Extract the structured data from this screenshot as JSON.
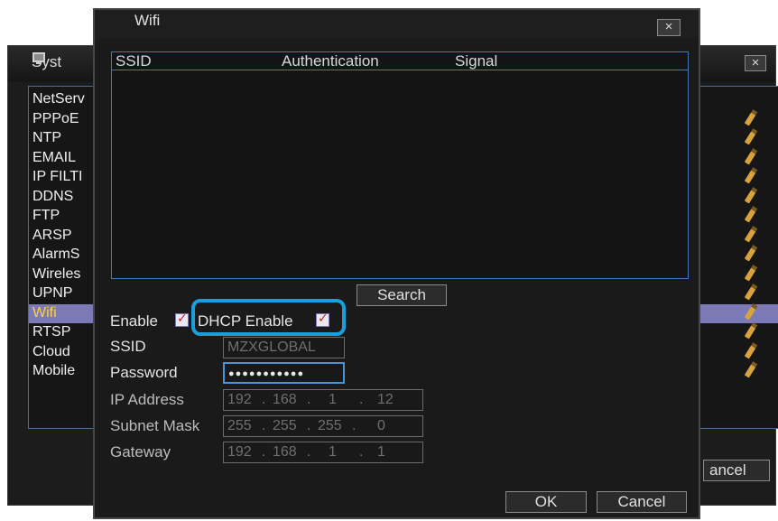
{
  "system_window": {
    "title": "Syst",
    "close_label": "×",
    "cancel_label": "ancel",
    "items": [
      {
        "label": "NetServ",
        "editable": false,
        "selected": false
      },
      {
        "label": "PPPoE",
        "editable": true,
        "selected": false
      },
      {
        "label": "NTP",
        "editable": true,
        "selected": false
      },
      {
        "label": "EMAIL",
        "editable": true,
        "selected": false
      },
      {
        "label": "IP FILTI",
        "editable": true,
        "selected": false
      },
      {
        "label": "DDNS",
        "editable": true,
        "selected": false
      },
      {
        "label": "FTP",
        "editable": true,
        "selected": false
      },
      {
        "label": "ARSP",
        "editable": true,
        "selected": false
      },
      {
        "label": "AlarmS",
        "editable": true,
        "selected": false
      },
      {
        "label": "Wireles",
        "editable": true,
        "selected": false
      },
      {
        "label": "UPNP",
        "editable": true,
        "selected": false
      },
      {
        "label": "Wifi",
        "editable": true,
        "selected": true
      },
      {
        "label": "RTSP",
        "editable": true,
        "selected": false
      },
      {
        "label": "Cloud",
        "editable": true,
        "selected": false
      },
      {
        "label": "Mobile",
        "editable": true,
        "selected": false
      }
    ]
  },
  "wifi_dialog": {
    "title": "Wifi",
    "close_label": "×",
    "table": {
      "columns": [
        "SSID",
        "Authentication",
        "Signal"
      ],
      "rows": []
    },
    "search_label": "Search",
    "enable_label": "Enable",
    "enable_checked": true,
    "dhcp_label": "DHCP Enable",
    "dhcp_checked": true,
    "ssid_label": "SSID",
    "ssid_value": "MZXGLOBAL",
    "password_label": "Password",
    "password_value": "●●●●●●●●●●●",
    "ip_label": "IP Address",
    "ip_parts": [
      "192",
      "168",
      "1",
      "12"
    ],
    "mask_label": "Subnet Mask",
    "mask_parts": [
      "255",
      "255",
      "255",
      "0"
    ],
    "gateway_label": "Gateway",
    "gateway_parts": [
      "192",
      "168",
      "1",
      "1"
    ],
    "ok_label": "OK",
    "cancel_label": "Cancel"
  },
  "colors": {
    "highlight_ring": "#1b9fdc",
    "selected_row": "#7b7ab6",
    "selected_text": "#ffd04a",
    "table_border": "#4677b4"
  },
  "icons": {
    "system": "monitor-icon",
    "edit": "pencil-icon",
    "close": "close-icon",
    "checkbox": "checkbox-checked-icon"
  }
}
